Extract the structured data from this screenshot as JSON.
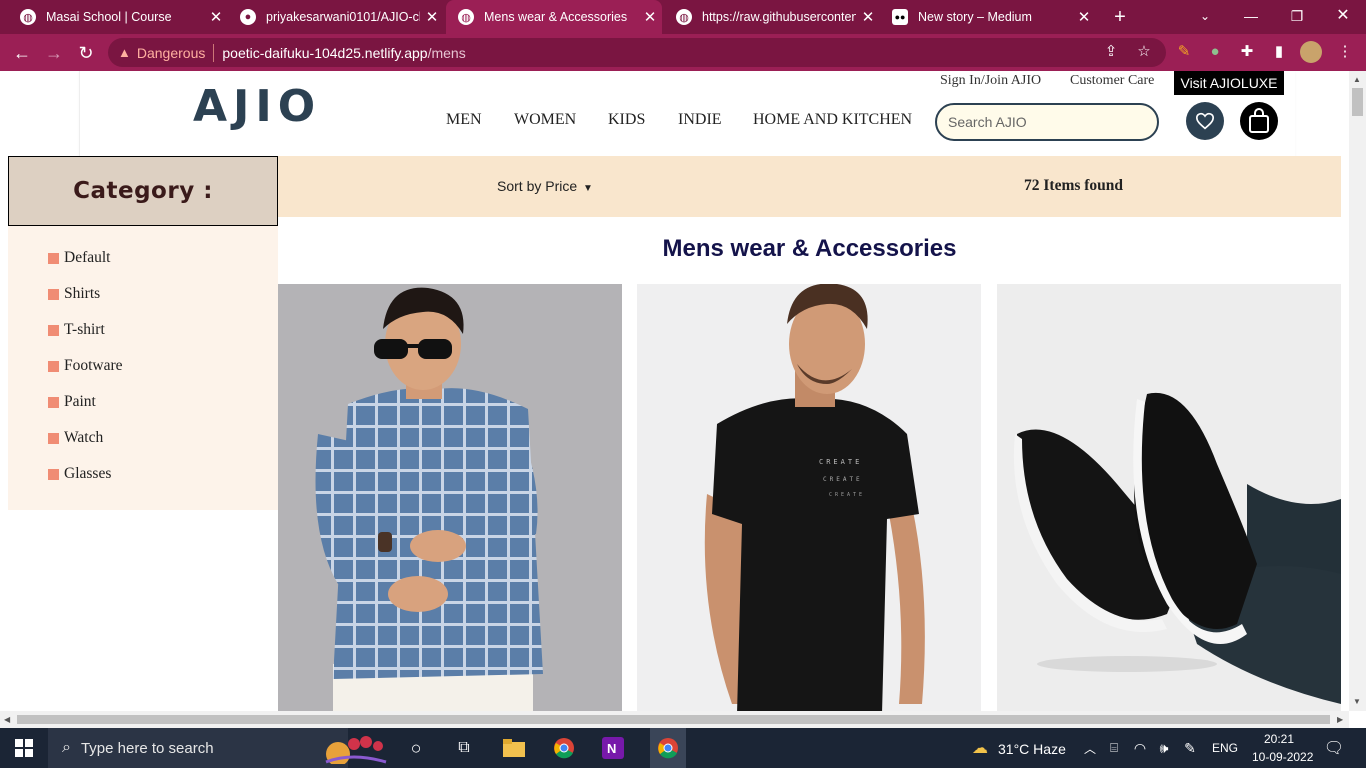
{
  "browser": {
    "tabs": [
      {
        "title": "Masai School | Course",
        "active": false
      },
      {
        "title": "priyakesarwani0101/AJIO-clo",
        "active": false
      },
      {
        "title": "Mens wear & Accessories",
        "active": true
      },
      {
        "title": "https://raw.githubuserconten",
        "active": false
      },
      {
        "title": "New story – Medium",
        "active": false
      }
    ],
    "security_label": "Dangerous",
    "url_host": "poetic-daifuku-104d25.netlify.app",
    "url_path": "/mens"
  },
  "header": {
    "logo": "AJIO",
    "sign_in": "Sign In/Join AJIO",
    "customer_care": "Customer Care",
    "luxe": "Visit AJIOLUXE",
    "nav": [
      "MEN",
      "WOMEN",
      "KIDS",
      "INDIE",
      "HOME AND KITCHEN"
    ],
    "search_placeholder": "Search AJIO"
  },
  "sidebar": {
    "title": "Category :",
    "items": [
      "Default",
      "Shirts",
      "T-shirt",
      "Footware",
      "Paint",
      "Watch",
      "Glasses"
    ]
  },
  "toolbar": {
    "sort_label": "Sort by Price",
    "count": "72 Items found"
  },
  "main": {
    "title": "Mens wear & Accessories",
    "products": [
      {
        "icon": "checked-shirt-product-image"
      },
      {
        "icon": "black-tshirt-product-image"
      },
      {
        "icon": "black-sneakers-product-image"
      }
    ]
  },
  "taskbar": {
    "search_placeholder": "Type here to search",
    "weather": "31°C  Haze",
    "lang": "ENG",
    "time": "20:21",
    "date": "10-09-2022"
  },
  "colors": {
    "chrome": "#7a1541",
    "chrome_active": "#9b1f55",
    "brand": "#2c4152",
    "sortbar": "#f9e6cd",
    "sidebar": "#fdf3ea",
    "bullet": "#f08c74"
  }
}
